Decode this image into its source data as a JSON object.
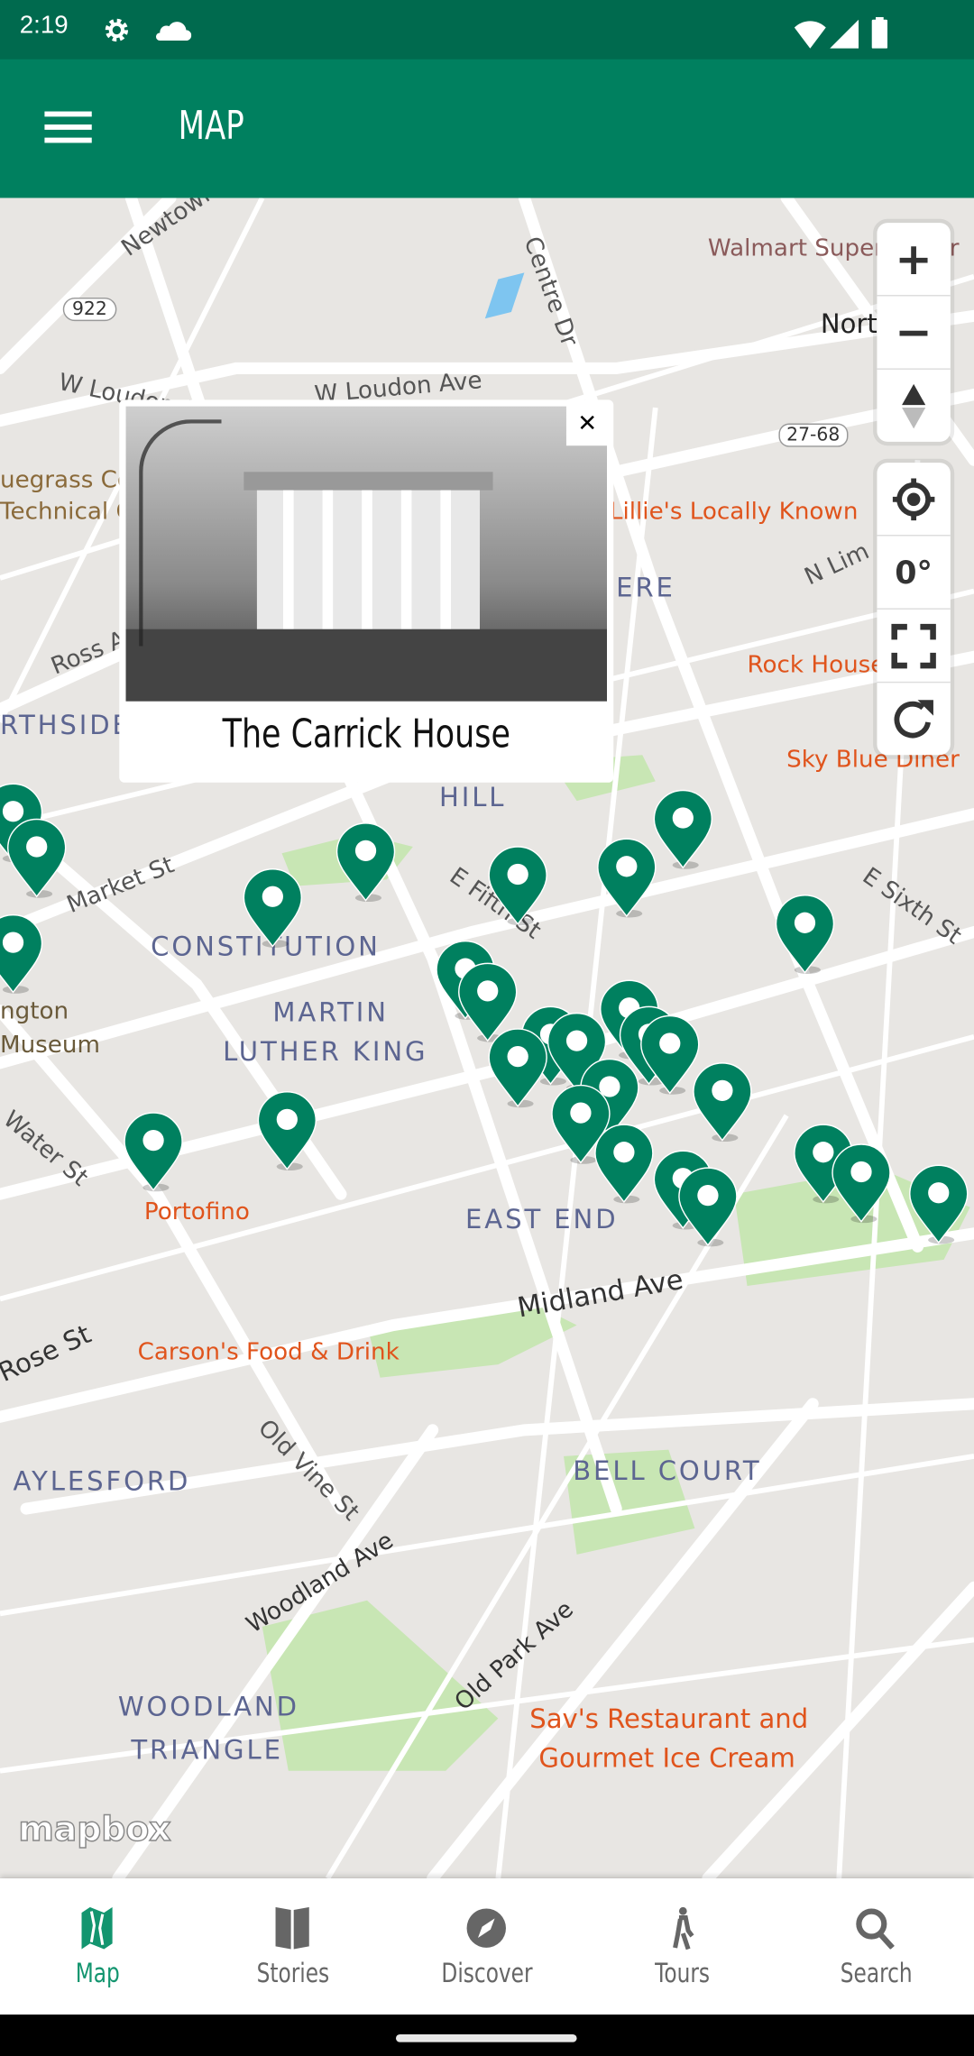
{
  "status_bar": {
    "time": "2:19",
    "icons": [
      "gear-icon",
      "cloud-icon",
      "wifi-icon",
      "signal-icon",
      "battery-icon"
    ]
  },
  "app_bar": {
    "title": "MAP",
    "menu_icon": "hamburger-icon"
  },
  "colors": {
    "primary": "#00805f",
    "status": "#006a4e",
    "marker": "#00805f",
    "active_tab": "#13956f",
    "poi": "#e0541c"
  },
  "map": {
    "labels": {
      "walmart": "Walmart Supercenter",
      "north": "North",
      "loudon1": "W Loudon Ave",
      "loudon2": "W Loudon Ave",
      "bluegrass1": "uegrass Co",
      "bluegrass2": "Technical C",
      "lillies": "Lillie's Locally Known",
      "ross": "Ross Ave",
      "northside": "RTHSIDE",
      "hill": "HILL",
      "rockhouse": "Rock House",
      "skyblue": "Sky Blue Diner",
      "market": "Market St",
      "fifth": "E Fifth St",
      "sixth": "E Sixth St",
      "constitution": "CONSTITUTION",
      "martin": "MARTIN",
      "lutherking": "LUTHER KING",
      "museum1": "ngton",
      "museum2": "Museum",
      "water": "Water St",
      "portofino": "Portofino",
      "eastend": "EAST END",
      "midland": "Midland Ave",
      "carsons": "Carson's Food & Drink",
      "rose": "Rose St",
      "oldvine": "Old Vine St",
      "aylesford": "AYLESFORD",
      "bellcourt": "BELL COURT",
      "woodlandave": "Woodland Ave",
      "oldpark": "Old Park Ave",
      "woodland": "WOODLAND",
      "triangle": "TRIANGLE",
      "savs1": "Sav's Restaurant and",
      "savs2": "Gourmet Ice Cream",
      "centre": "Centre Dr",
      "newtown": "Newtown",
      "limestone": "N Lim",
      "shield922": "922",
      "shield2768": "27-68",
      "park": "ERE"
    },
    "attribution": "mapbox",
    "marker_count": 28
  },
  "popup": {
    "title": "The Carrick House",
    "close_icon": "close-icon"
  },
  "controls": {
    "zoom_in": "+",
    "zoom_out": "−",
    "compass": "compass-icon",
    "locate": "locate-icon",
    "bearing": "0°",
    "fullscreen": "fullscreen-icon",
    "refresh": "refresh-icon"
  },
  "bottom_nav": {
    "items": [
      {
        "label": "Map",
        "icon": "map-icon",
        "active": true
      },
      {
        "label": "Stories",
        "icon": "book-icon"
      },
      {
        "label": "Discover",
        "icon": "compass-icon"
      },
      {
        "label": "Tours",
        "icon": "walking-icon"
      },
      {
        "label": "Search",
        "icon": "search-icon"
      }
    ]
  }
}
